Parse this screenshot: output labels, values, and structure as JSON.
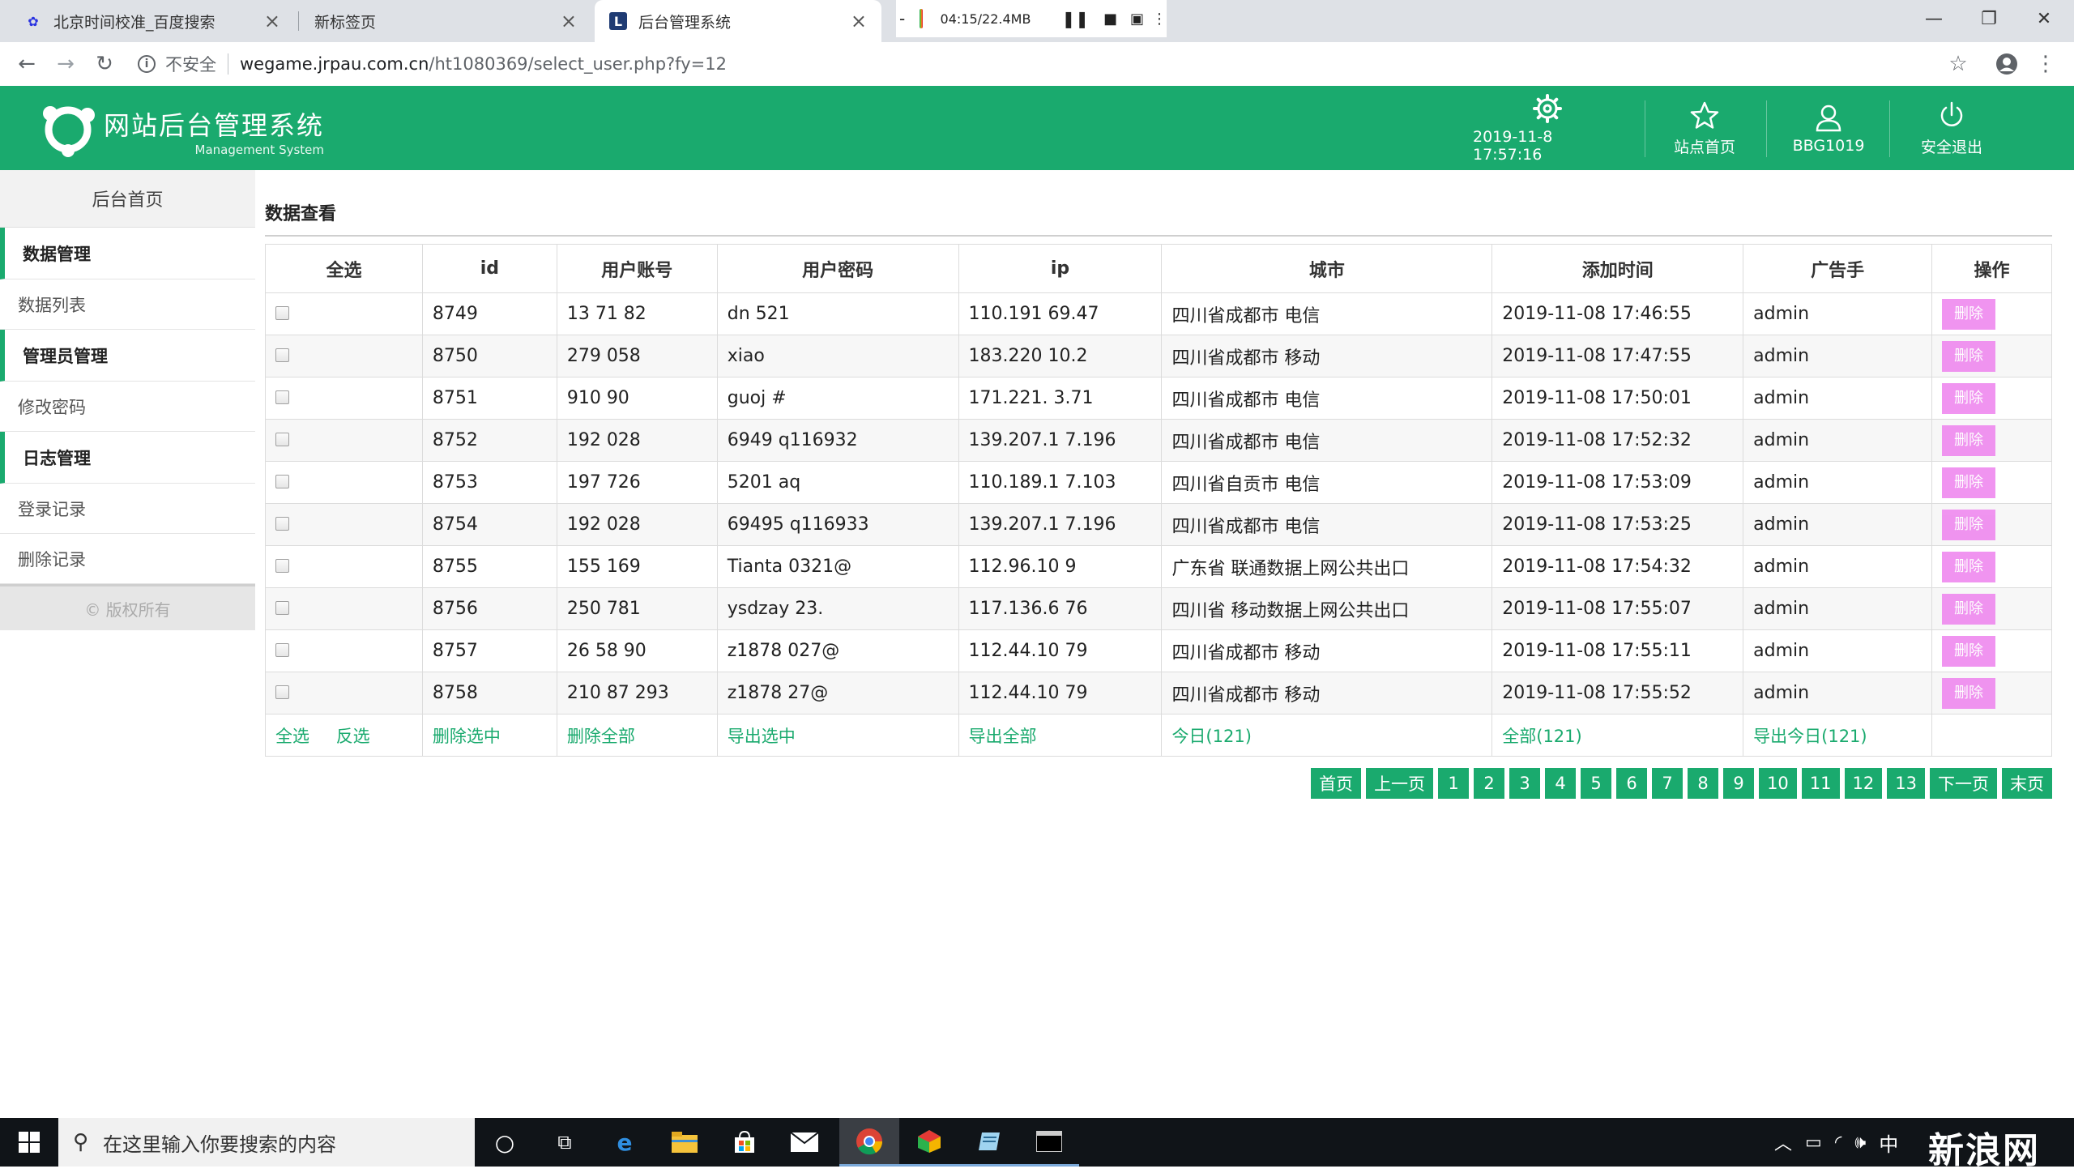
{
  "browser": {
    "tabs": [
      {
        "title": "北京时间校准_百度搜索",
        "favicon": "baidu-paw-icon"
      },
      {
        "title": "新标签页",
        "favicon": ""
      },
      {
        "title": "后台管理系统",
        "favicon": "site-logo-icon",
        "active": true
      }
    ],
    "recorder": {
      "status": "04:15/22.4MB"
    },
    "address": {
      "security_label": "不安全",
      "host": "wegame.jrpau.com.cn",
      "path": "/ht1080369/select_user.php?fy=12"
    }
  },
  "header": {
    "brand_cn": "网站后台管理系统",
    "brand_en": "Management System",
    "datetime": "2019-11-8 17:57:16",
    "site_home": "站点首页",
    "username": "BBG1019",
    "logout": "安全退出",
    "accent_color": "#1aaa6e"
  },
  "sidebar": {
    "home": "后台首页",
    "sections": [
      {
        "title": "数据管理",
        "items": [
          "数据列表"
        ]
      },
      {
        "title": "管理员管理",
        "items": [
          "修改密码"
        ]
      },
      {
        "title": "日志管理",
        "items": [
          "登录记录",
          "删除记录"
        ]
      }
    ],
    "footer": "© 版权所有"
  },
  "main": {
    "title": "数据查看",
    "columns": [
      "全选",
      "id",
      "用户账号",
      "用户密码",
      "ip",
      "城市",
      "添加时间",
      "广告手",
      "操作"
    ],
    "delete_label": "删除",
    "rows": [
      {
        "id": "8749",
        "account": "13 71 82",
        "password": "dn 521",
        "ip": "110.191 69.47",
        "city": "四川省成都市 电信",
        "time": "2019-11-08 17:46:55",
        "ad": "admin"
      },
      {
        "id": "8750",
        "account": "279 058",
        "password": "xiao",
        "ip": "183.220 10.2",
        "city": "四川省成都市 移动",
        "time": "2019-11-08 17:47:55",
        "ad": "admin"
      },
      {
        "id": "8751",
        "account": "910 90",
        "password": "guoj #",
        "ip": "171.221. 3.71",
        "city": "四川省成都市 电信",
        "time": "2019-11-08 17:50:01",
        "ad": "admin"
      },
      {
        "id": "8752",
        "account": "192 028",
        "password": "6949 q116932",
        "ip": "139.207.1 7.196",
        "city": "四川省成都市 电信",
        "time": "2019-11-08 17:52:32",
        "ad": "admin"
      },
      {
        "id": "8753",
        "account": "197 726",
        "password": "5201 aq",
        "ip": "110.189.1 7.103",
        "city": "四川省自贡市 电信",
        "time": "2019-11-08 17:53:09",
        "ad": "admin"
      },
      {
        "id": "8754",
        "account": "192 028",
        "password": "69495 q116933",
        "ip": "139.207.1 7.196",
        "city": "四川省成都市 电信",
        "time": "2019-11-08 17:53:25",
        "ad": "admin"
      },
      {
        "id": "8755",
        "account": "155 169",
        "password": "Tianta 0321@",
        "ip": "112.96.10 9",
        "city": "广东省 联通数据上网公共出口",
        "time": "2019-11-08 17:54:32",
        "ad": "admin"
      },
      {
        "id": "8756",
        "account": "250 781",
        "password": "ysdzay 23.",
        "ip": "117.136.6 76",
        "city": "四川省 移动数据上网公共出口",
        "time": "2019-11-08 17:55:07",
        "ad": "admin"
      },
      {
        "id": "8757",
        "account": "26 58 90",
        "password": "z1878 027@",
        "ip": "112.44.10 79",
        "city": "四川省成都市 移动",
        "time": "2019-11-08 17:55:11",
        "ad": "admin"
      },
      {
        "id": "8758",
        "account": "210 87 293",
        "password": "z1878 27@",
        "ip": "112.44.10 79",
        "city": "四川省成都市 移动",
        "time": "2019-11-08 17:55:52",
        "ad": "admin"
      }
    ],
    "actions": {
      "select_all": "全选",
      "invert": "反选",
      "delete_selected": "删除选中",
      "delete_all": "删除全部",
      "export_selected": "导出选中",
      "export_all": "导出全部",
      "today": "今日(121)",
      "all": "全部(121)",
      "export_today": "导出今日(121)"
    },
    "pager": [
      "首页",
      "上一页",
      "1",
      "2",
      "3",
      "4",
      "5",
      "6",
      "7",
      "8",
      "9",
      "10",
      "11",
      "12",
      "13",
      "下一页",
      "末页"
    ]
  },
  "taskbar": {
    "search_placeholder": "在这里输入你要搜索的内容",
    "ime": "中",
    "watermark": "新浪网"
  }
}
